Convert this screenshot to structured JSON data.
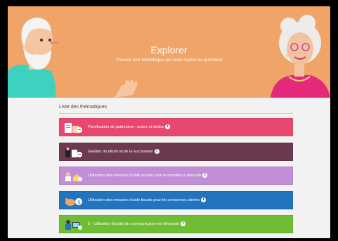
{
  "header": {
    "title": "Explorer",
    "subtitle": "Trouver une thématique qui vous rejoint au quotidien"
  },
  "list": {
    "title": "Liste des thématiques",
    "info_glyph": "i",
    "items": [
      {
        "label": "Planification de patrimoine : avoirs et dettes",
        "color": "#e8486f"
      },
      {
        "label": "Gestion du décès et de la succession",
        "color": "#6c3950"
      },
      {
        "label": "Utilisation des mesures d'aide sociale pour le maintien à domicile",
        "color": "#c28ed6"
      },
      {
        "label": "Utilisation des mesures d'aide fiscale pour les personnes aînées",
        "color": "#2374bf"
      },
      {
        "label": "5 - Utilisation d'outils de communication en télésanté",
        "color": "#6fbd35"
      }
    ]
  },
  "colors": {
    "hero_bg": "#f0a468",
    "page_bg": "#f2f2f2"
  }
}
